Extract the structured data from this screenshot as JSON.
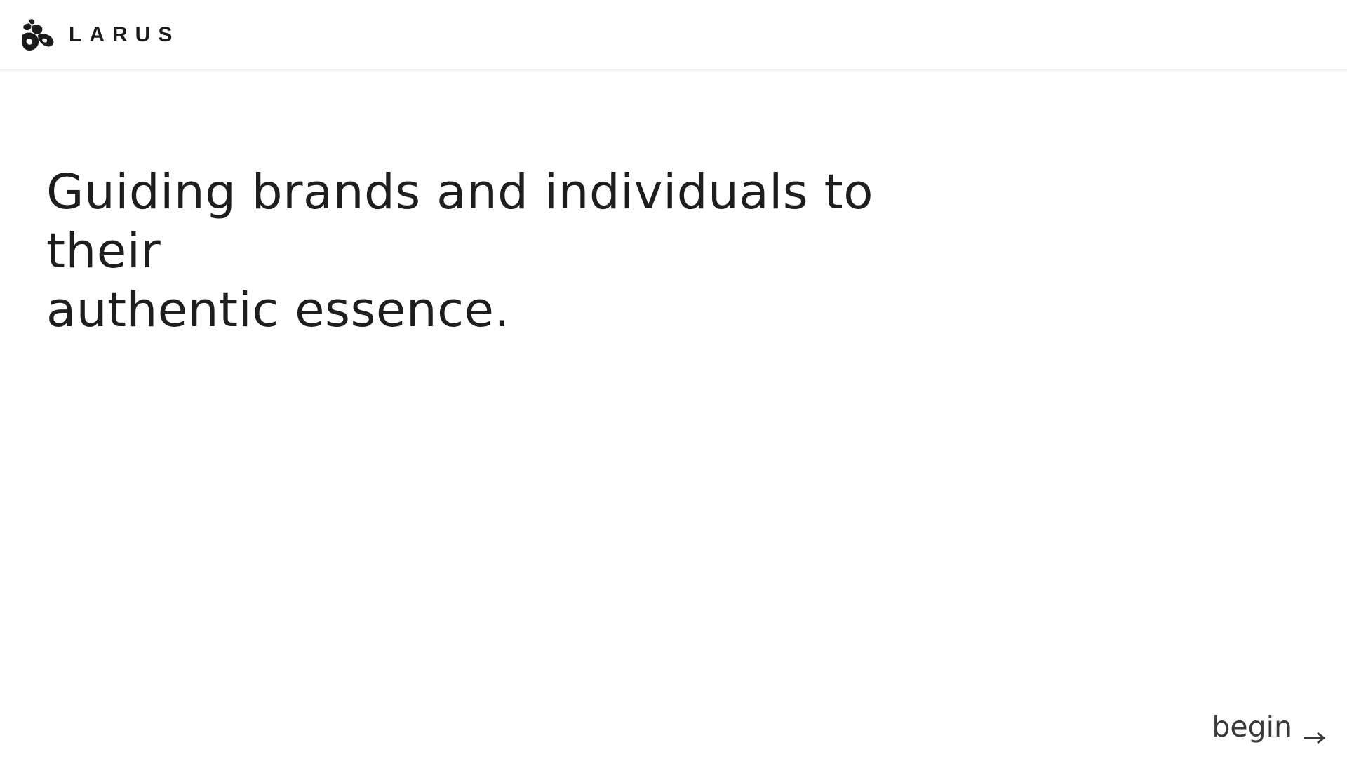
{
  "header": {
    "brand_name": "LARUS",
    "logo_icon": "larus-bird-logo-icon"
  },
  "hero": {
    "line1": "Guiding brands and individuals to their",
    "line2": "authentic essence."
  },
  "cta": {
    "label": "begin",
    "icon": "arrow-right-icon"
  },
  "colors": {
    "text": "#1e1e1e",
    "background": "#ffffff",
    "cta_text": "#3a3a3a"
  }
}
